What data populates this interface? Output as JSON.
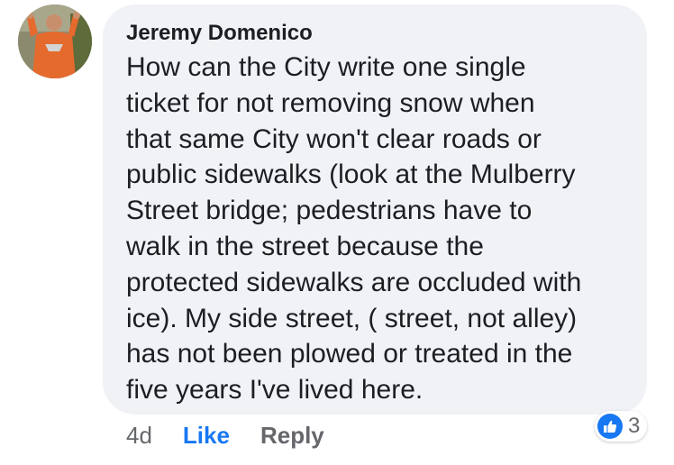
{
  "comment": {
    "author": "Jeremy Domenico",
    "text_lines": [
      "How can the City write one single",
      "ticket for not removing snow when",
      "that same City won't clear roads or",
      "public sidewalks (look at the Mulberry",
      "Street bridge; pedestrians have to",
      "walk in the street because the",
      "protected sidewalks are occluded with",
      "ice). My side street, ( street, not alley)",
      "has not been plowed or treated in the",
      "five years I've lived here."
    ],
    "timestamp": "4d",
    "like_label": "Like",
    "reply_label": "Reply",
    "reaction_count": "3",
    "reaction_icon": "thumbs-up-icon"
  },
  "colors": {
    "bubble_bg": "#f1f2f6",
    "link_blue": "#1877f2",
    "meta_gray": "#65676b",
    "text": "#1c1e21"
  }
}
